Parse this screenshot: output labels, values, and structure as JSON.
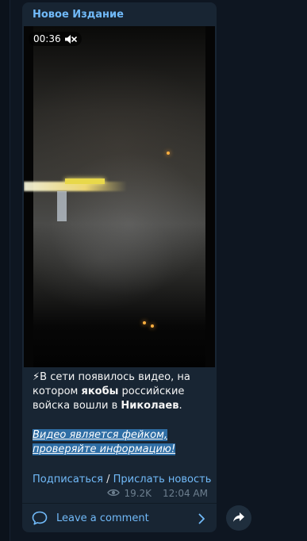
{
  "message": {
    "channel_name": "Новое Издание",
    "video": {
      "duration": "00:36",
      "mute_icon": "mute-icon"
    },
    "text": {
      "emoji": "⚡",
      "line1_a": "В сети появилось видео, на котором ",
      "bold1": "якобы",
      "line1_b": " российские войска вошли в ",
      "bold2": "Николаев",
      "line1_c": "."
    },
    "highlight": "Видео является фейком, проверяйте информацию!",
    "links": {
      "subscribe": "Подписаться",
      "separator": " / ",
      "send_news": "Прислать новость"
    },
    "views": "19.2K",
    "time": "12:04 AM",
    "comment_label": "Leave a comment"
  },
  "colors": {
    "background": "#0e1621",
    "bubble": "#182533",
    "accent": "#71baf9",
    "highlight": "#2f6ea5"
  }
}
